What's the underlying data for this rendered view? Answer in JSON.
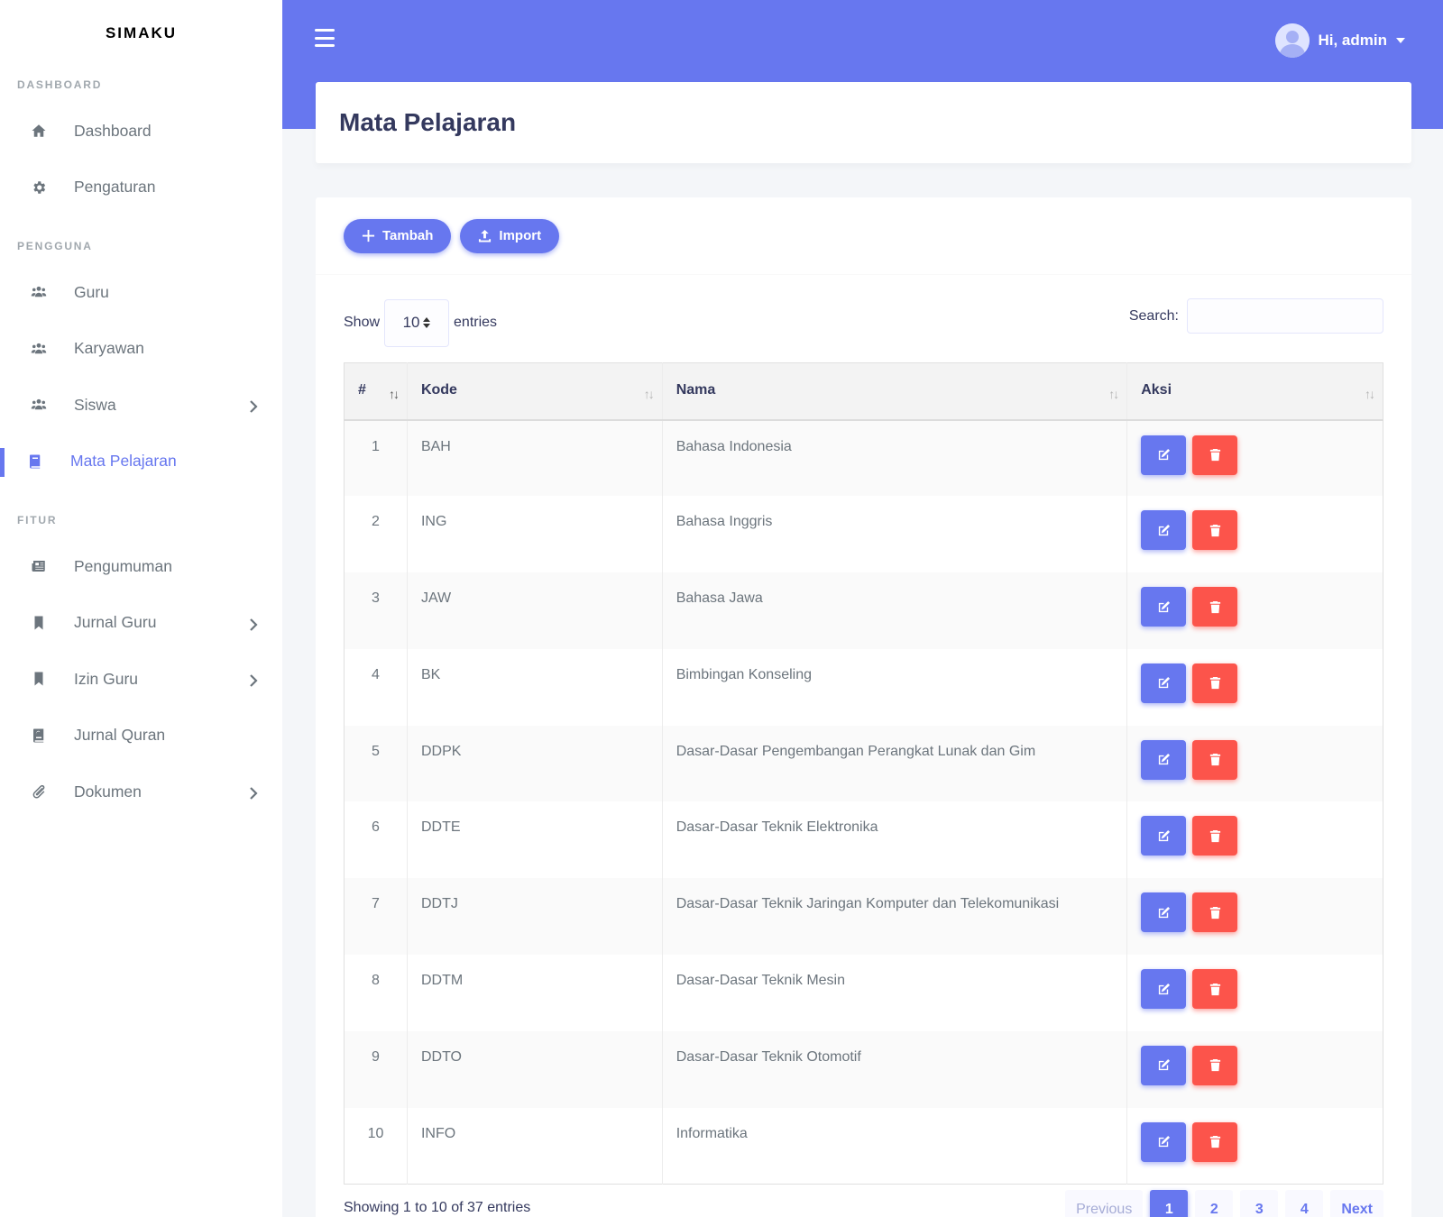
{
  "brand": "SIMAKU",
  "sidebar": {
    "sections": {
      "dashboard": "DASHBOARD",
      "pengguna": "PENGGUNA",
      "fitur": "FITUR"
    },
    "items": {
      "dashboard": "Dashboard",
      "pengaturan": "Pengaturan",
      "guru": "Guru",
      "karyawan": "Karyawan",
      "siswa": "Siswa",
      "mata_pelajaran": "Mata Pelajaran",
      "pengumuman": "Pengumuman",
      "jurnal_guru": "Jurnal Guru",
      "izin_guru": "Izin Guru",
      "jurnal_quran": "Jurnal Quran",
      "dokumen": "Dokumen"
    }
  },
  "topbar": {
    "user_label": "Hi, admin"
  },
  "page": {
    "title": "Mata Pelajaran"
  },
  "toolbar": {
    "add_label": "Tambah",
    "import_label": "Import"
  },
  "datatable": {
    "show_label": "Show",
    "entries_label": "entries",
    "length_value": "10",
    "search_label": "Search:",
    "search_value": "",
    "columns": [
      "#",
      "Kode",
      "Nama",
      "Aksi"
    ],
    "rows": [
      {
        "no": "1",
        "kode": "BAH",
        "nama": "Bahasa Indonesia"
      },
      {
        "no": "2",
        "kode": "ING",
        "nama": "Bahasa Inggris"
      },
      {
        "no": "3",
        "kode": "JAW",
        "nama": "Bahasa Jawa"
      },
      {
        "no": "4",
        "kode": "BK",
        "nama": "Bimbingan Konseling"
      },
      {
        "no": "5",
        "kode": "DDPK",
        "nama": "Dasar-Dasar Pengembangan Perangkat Lunak dan Gim"
      },
      {
        "no": "6",
        "kode": "DDTE",
        "nama": "Dasar-Dasar Teknik Elektronika"
      },
      {
        "no": "7",
        "kode": "DDTJ",
        "nama": "Dasar-Dasar Teknik Jaringan Komputer dan Telekomunikasi"
      },
      {
        "no": "8",
        "kode": "DDTM",
        "nama": "Dasar-Dasar Teknik Mesin"
      },
      {
        "no": "9",
        "kode": "DDTO",
        "nama": "Dasar-Dasar Teknik Otomotif"
      },
      {
        "no": "10",
        "kode": "INFO",
        "nama": "Informatika"
      }
    ],
    "info": "Showing 1 to 10 of 37 entries",
    "pagination": {
      "previous": "Previous",
      "pages": [
        "1",
        "2",
        "3",
        "4"
      ],
      "active_page": "1",
      "next": "Next"
    }
  },
  "colors": {
    "primary": "#6777ef",
    "danger": "#fc544b",
    "background": "#f4f6f9"
  },
  "icons": {
    "dashboard": "home-icon",
    "pengaturan": "gear-icon",
    "guru": "users-icon",
    "karyawan": "users-icon",
    "siswa": "users-icon",
    "mata_pelajaran": "book-icon",
    "pengumuman": "newspaper-icon",
    "jurnal_guru": "bookmark-icon",
    "izin_guru": "bookmark-icon",
    "jurnal_quran": "quran-book-icon",
    "dokumen": "paperclip-icon",
    "edit": "edit-icon",
    "delete": "trash-icon"
  }
}
